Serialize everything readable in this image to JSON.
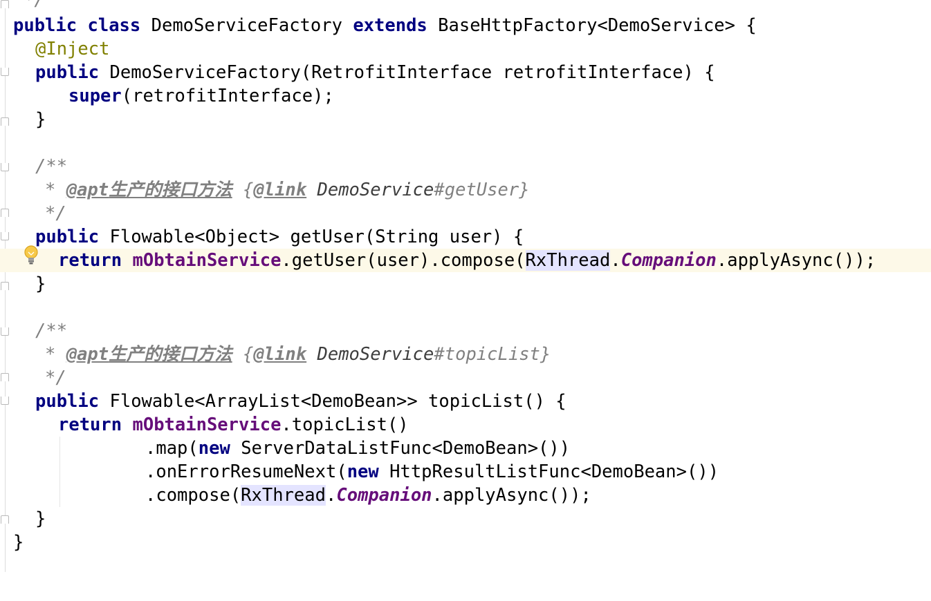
{
  "editor": {
    "lines": {
      "l0": "*/",
      "l1": {
        "kw1": "public",
        "kw2": "class",
        "t1": "DemoServiceFactory",
        "kw3": "extends",
        "t2": "BaseHttpFactory<DemoService> {"
      },
      "l2": {
        "ann": "@Inject"
      },
      "l3": {
        "kw": "public",
        "t": "DemoServiceFactory(RetrofitInterface retrofitInterface) {"
      },
      "l4": {
        "kw": "super",
        "t": "(retrofitInterface);"
      },
      "l5": "}",
      "l7": "/**",
      "l8": {
        "star": "* ",
        "tag": "@apt",
        "cjk": "生产的接口方法",
        "open": "{",
        "link": "@link",
        "ref": "DemoService",
        "hash": "#getUser",
        "close": "}"
      },
      "l9": "*/",
      "l10": {
        "kw": "public",
        "t": "Flowable<Object> getUser(String user) {"
      },
      "l11": {
        "kw": "return",
        "field": "mObtainService",
        "t1": ".getUser(user).compose(",
        "hl": "RxThread",
        "dot": ".",
        "static": "Companion",
        "t2": ".applyAsync());"
      },
      "l12": "}",
      "l14": "/**",
      "l15": {
        "star": "* ",
        "tag": "@apt",
        "cjk": "生产的接口方法",
        "open": "{",
        "link": "@link",
        "ref": "DemoService",
        "hash": "#topicList",
        "close": "}"
      },
      "l16": "*/",
      "l17": {
        "kw": "public",
        "t": "Flowable<ArrayList<DemoBean>> topicList() {"
      },
      "l18": {
        "kw": "return",
        "field": "mObtainService",
        "t": ".topicList()"
      },
      "l19": {
        "t1": ".map(",
        "kw": "new",
        "t2": "ServerDataListFunc<DemoBean>())"
      },
      "l20": {
        "t1": ".onErrorResumeNext(",
        "kw": "new",
        "t2": "HttpResultListFunc<DemoBean>())"
      },
      "l21": {
        "t1": ".compose(",
        "hl": "RxThread",
        "dot": ".",
        "static": "Companion",
        "t2": ".applyAsync());"
      },
      "l22": "}",
      "l23": "}"
    },
    "icons": {
      "intention": "lightbulb-icon"
    },
    "colors": {
      "keyword": "#000080",
      "annotation": "#808000",
      "field": "#660e7a",
      "comment": "#808080",
      "current_line": "#fdf9e8",
      "usage_highlight": "#e4e4ff"
    }
  }
}
